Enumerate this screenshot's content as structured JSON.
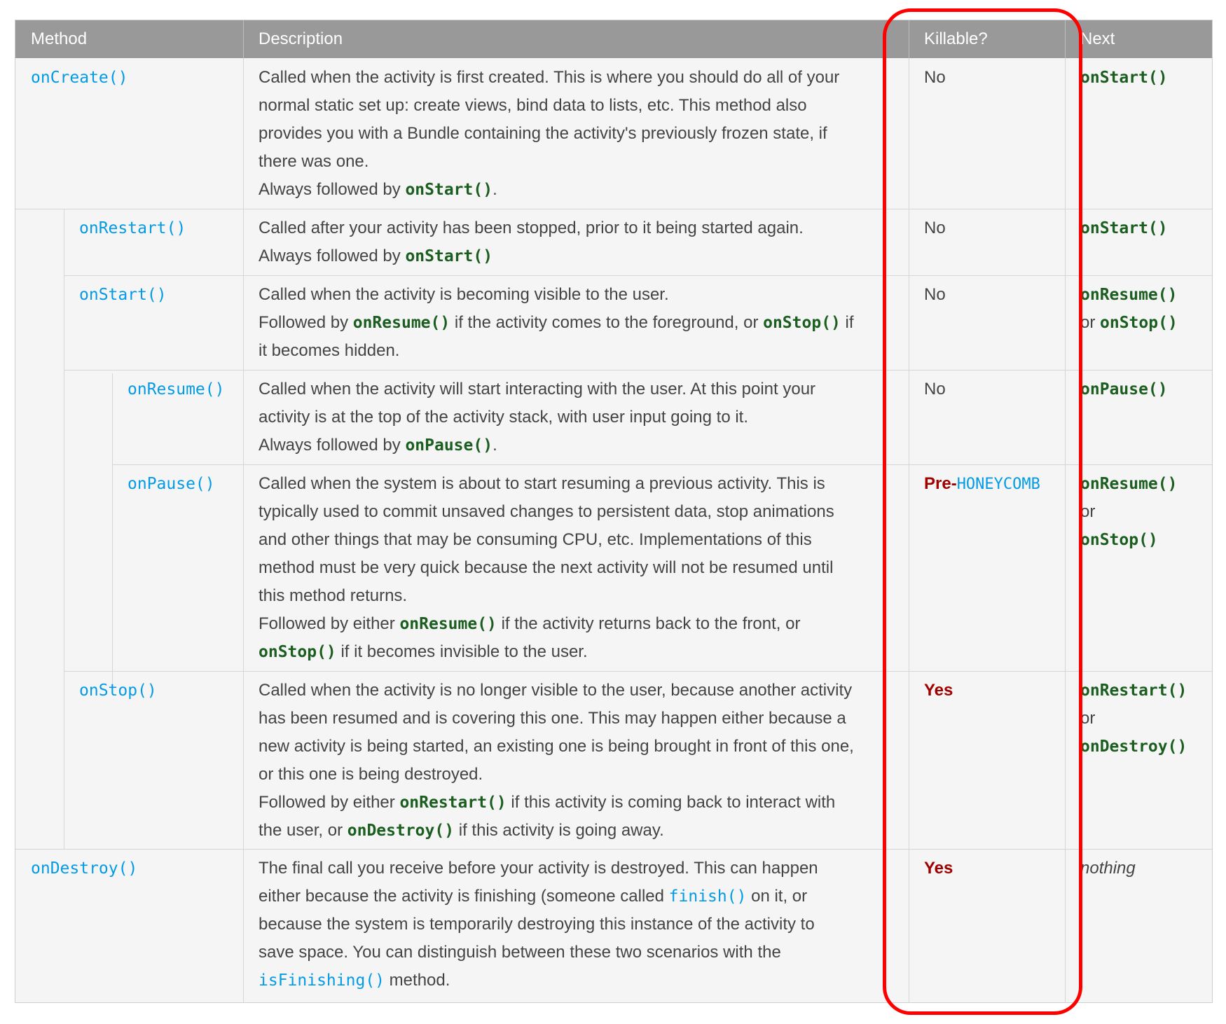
{
  "header": {
    "method": "Method",
    "description": "Description",
    "killable": "Killable?",
    "next": "Next"
  },
  "rows": [
    {
      "method": "onCreate()",
      "desc": [
        "Called when the activity is first created. This is where you should do all of your",
        "normal static set up: create views, bind data to lists, etc. This method also",
        "provides you with a Bundle containing the activity's previously frozen state, if",
        "there was one.",
        [
          "Always followed by ",
          "onStart()",
          "."
        ]
      ],
      "killable": "No",
      "next": [
        "onStart()"
      ]
    },
    {
      "method": "onRestart()",
      "desc": [
        "Called after your activity has been stopped, prior to it being started again.",
        [
          "Always followed by ",
          "onStart()",
          ""
        ]
      ],
      "killable": "No",
      "next": [
        "onStart()"
      ]
    },
    {
      "method": "onStart()",
      "desc": [
        "Called when the activity is becoming visible to the user.",
        [
          "Followed by ",
          "onResume()",
          " if the activity comes to the foreground, or ",
          "onStop()",
          " if"
        ],
        "it becomes hidden."
      ],
      "killable": "No",
      "next": [
        "onResume()",
        [
          "or ",
          "onStop()"
        ]
      ]
    },
    {
      "method": "onResume()",
      "desc": [
        "Called when the activity will start interacting with the user. At this point your",
        "activity is at the top of the activity stack, with user input going to it.",
        [
          "Always followed by ",
          "onPause()",
          "."
        ]
      ],
      "killable": "No",
      "next": [
        "onPause()"
      ]
    },
    {
      "method": "onPause()",
      "desc": [
        "Called when the system is about to start resuming a previous activity. This is",
        "typically used to commit unsaved changes to persistent data, stop animations",
        "and other things that may be consuming CPU, etc. Implementations of this",
        "method must be very quick because the next activity will not be resumed until",
        "this method returns.",
        [
          "Followed by either ",
          "onResume()",
          " if the activity returns back to the front, or"
        ],
        [
          "",
          "onStop()",
          " if it becomes invisible to the user."
        ]
      ],
      "killable_pre": "Pre-",
      "killable_hc": "HONEYCOMB",
      "next": [
        "onResume()",
        "or",
        "onStop()"
      ]
    },
    {
      "method": "onStop()",
      "desc": [
        "Called when the activity is no longer visible to the user, because another activity",
        "has been resumed and is covering this one. This may happen either because a",
        "new activity is being started, an existing one is being brought in front of this one,",
        "or this one is being destroyed.",
        [
          "Followed by either ",
          "onRestart()",
          " if this activity is coming back to interact with"
        ],
        [
          "the user, or ",
          "onDestroy()",
          " if this activity is going away."
        ]
      ],
      "killable": "Yes",
      "next": [
        "onRestart()",
        "or",
        "onDestroy()"
      ]
    },
    {
      "method": "onDestroy()",
      "desc": [
        "The final call you receive before your activity is destroyed. This can happen",
        [
          "either because the activity is finishing (someone called ",
          "finish()",
          " on it, or"
        ],
        "because the system is temporarily destroying this instance of the activity to",
        "save space. You can distinguish between these two scenarios with the",
        [
          "",
          "isFinishing()",
          " method."
        ]
      ],
      "killable": "Yes",
      "next_italic": "nothing"
    }
  ]
}
